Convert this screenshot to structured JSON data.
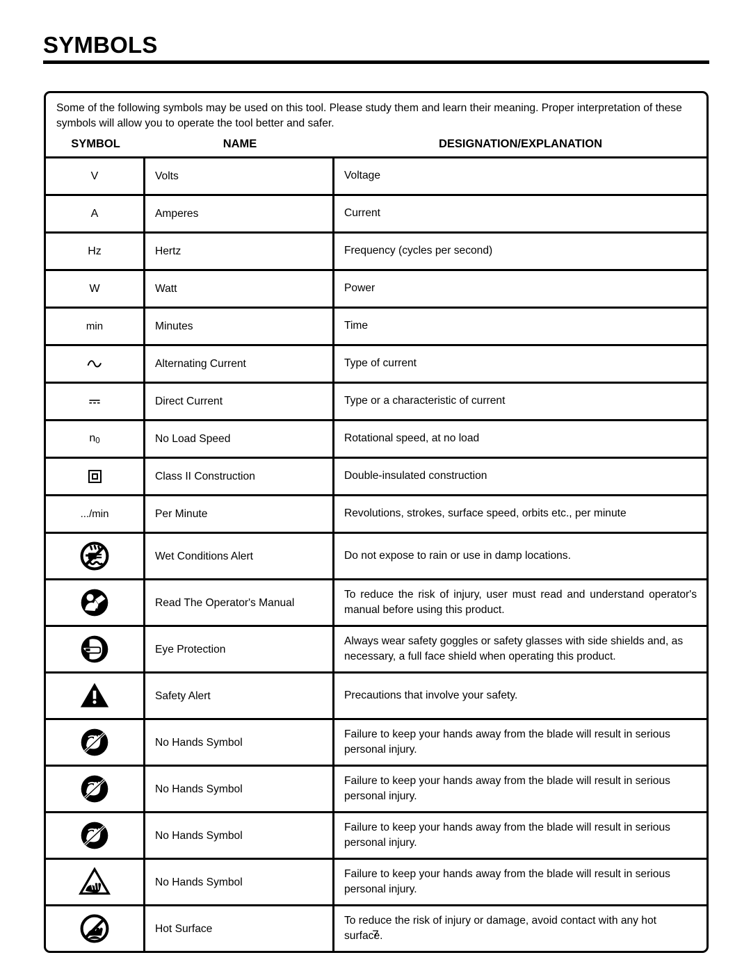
{
  "document": {
    "title": "SYMBOLS",
    "page_number": "7",
    "intro": "Some of the following symbols may be used on this tool. Please study them and learn their meaning. Proper interpretation of these symbols will allow you to operate the tool better and safer.",
    "colors": {
      "ink": "#000000",
      "paper": "#ffffff"
    }
  },
  "table": {
    "headers": {
      "symbol": "SYMBOL",
      "name": "NAME",
      "designation": "DESIGNATION/EXPLANATION"
    },
    "rows": [
      {
        "symbol_kind": "text",
        "symbol_text": "V",
        "name": "Volts",
        "designation": "Voltage",
        "icon": "letter-v-symbol"
      },
      {
        "symbol_kind": "text",
        "symbol_text": "A",
        "name": "Amperes",
        "designation": "Current",
        "icon": "letter-a-symbol"
      },
      {
        "symbol_kind": "text",
        "symbol_text": "Hz",
        "name": "Hertz",
        "designation": "Frequency (cycles per second)",
        "icon": "hertz-symbol"
      },
      {
        "symbol_kind": "text",
        "symbol_text": "W",
        "name": "Watt",
        "designation": "Power",
        "icon": "watt-symbol"
      },
      {
        "symbol_kind": "text",
        "symbol_text": "min",
        "name": "Minutes",
        "designation": "Time",
        "icon": "minutes-symbol"
      },
      {
        "symbol_kind": "ac",
        "symbol_text": "",
        "name": "Alternating Current",
        "designation": "Type of current",
        "icon": "alternating-current-icon"
      },
      {
        "symbol_kind": "dc",
        "symbol_text": "",
        "name": "Direct Current",
        "designation": "Type or a characteristic of current",
        "icon": "direct-current-icon"
      },
      {
        "symbol_kind": "noload",
        "symbol_text": "n0",
        "name": "No Load Speed",
        "designation": "Rotational speed, at no load",
        "icon": "no-load-speed-icon"
      },
      {
        "symbol_kind": "classii",
        "symbol_text": "",
        "name": "Class II Construction",
        "designation": "Double-insulated construction",
        "icon": "class-two-construction-icon"
      },
      {
        "symbol_kind": "text",
        "symbol_text": ".../min",
        "name": "Per Minute",
        "designation": "Revolutions, strokes, surface speed, orbits etc., per minute",
        "icon": "per-minute-symbol"
      },
      {
        "symbol_kind": "pict-wet",
        "symbol_text": "",
        "name": "Wet Conditions Alert",
        "designation": "Do not expose to rain or use in damp locations.",
        "icon": "wet-conditions-alert-icon"
      },
      {
        "symbol_kind": "pict-manual",
        "symbol_text": "",
        "name": "Read The Operator's Manual",
        "designation": "To reduce the risk of injury, user must read and understand operator's manual before using this product.",
        "justify": true,
        "icon": "read-operators-manual-icon"
      },
      {
        "symbol_kind": "pict-eye",
        "symbol_text": "",
        "name": "Eye Protection",
        "designation": "Always wear safety goggles or safety glasses with side shields and, as necessary, a full face shield when operating this product.",
        "icon": "eye-protection-icon"
      },
      {
        "symbol_kind": "pict-alert",
        "symbol_text": "",
        "name": "Safety Alert",
        "designation": "Precautions that involve your safety.",
        "icon": "safety-alert-icon"
      },
      {
        "symbol_kind": "pict-nohands-1",
        "symbol_text": "",
        "name": "No Hands Symbol",
        "designation": "Failure to keep your hands away from the blade will result in serious personal injury.",
        "icon": "no-hands-icon-1"
      },
      {
        "symbol_kind": "pict-nohands-2",
        "symbol_text": "",
        "name": "No Hands Symbol",
        "designation": "Failure to keep your hands away from the blade will result in serious personal injury.",
        "icon": "no-hands-icon-2"
      },
      {
        "symbol_kind": "pict-nohands-3",
        "symbol_text": "",
        "name": "No Hands Symbol",
        "designation": "Failure to keep your hands away from the blade will result in serious personal injury.",
        "icon": "no-hands-icon-3"
      },
      {
        "symbol_kind": "pict-nohands-tri",
        "symbol_text": "",
        "name": "No Hands Symbol",
        "designation": "Failure to keep your hands away from the blade will result in serious personal injury.",
        "icon": "no-hands-triangle-icon"
      },
      {
        "symbol_kind": "pict-hot",
        "symbol_text": "",
        "name": "Hot Surface",
        "designation": "To reduce the risk of injury or damage, avoid contact with any hot surface.",
        "icon": "hot-surface-icon"
      }
    ]
  }
}
